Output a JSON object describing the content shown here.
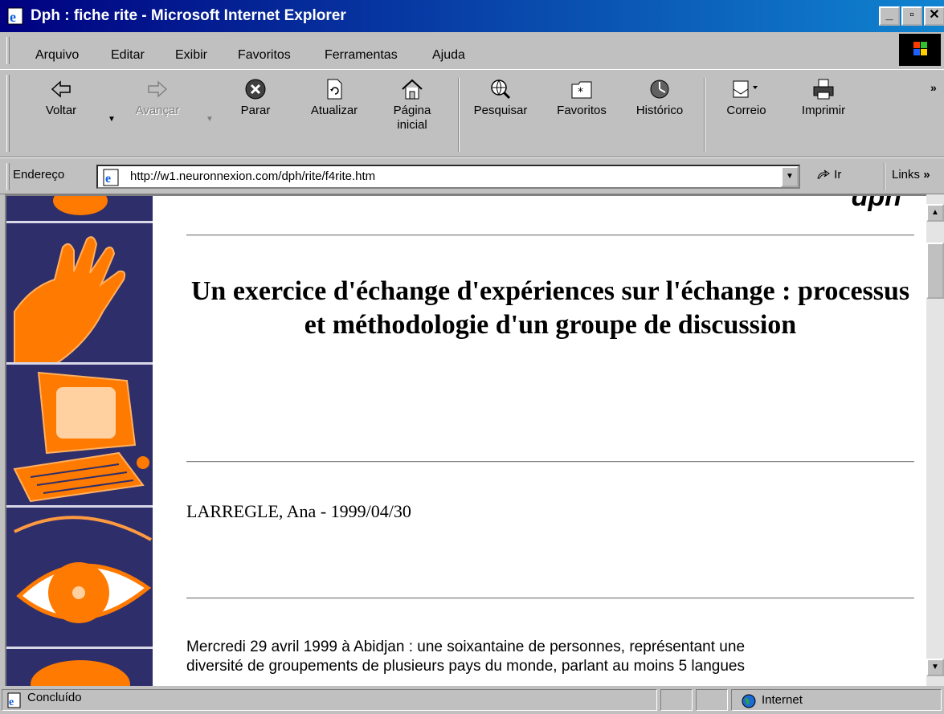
{
  "window": {
    "title": "Dph : fiche rite - Microsoft Internet Explorer",
    "min_label": "_",
    "max_label": "▫",
    "close_label": "✕"
  },
  "menu": {
    "items": [
      "Arquivo",
      "Editar",
      "Exibir",
      "Favoritos",
      "Ferramentas",
      "Ajuda"
    ]
  },
  "toolbar": {
    "back": "Voltar",
    "forward": "Avançar",
    "stop": "Parar",
    "refresh": "Atualizar",
    "home_line1": "Página",
    "home_line2": "inicial",
    "search": "Pesquisar",
    "favorites": "Favoritos",
    "history": "Histórico",
    "mail": "Correio",
    "print": "Imprimir",
    "more": "»"
  },
  "address": {
    "label": "Endereço",
    "url": "http://w1.neuronnexion.com/dph/rite/f4rite.htm",
    "go_label": "Ir",
    "links_label": "Links",
    "links_more": "»"
  },
  "page": {
    "logo": "dph",
    "title": "Un exercice d'échange d'expériences sur l'échange : processus et méthodologie d'un groupe de discussion",
    "author": "LARREGLE, Ana - 1999/04/30",
    "body_line1": "Mercredi 29 avril 1999 à Abidjan : une soixantaine de personnes, représentant une",
    "body_line2": "diversité de groupements de plusieurs pays du monde, parlant au moins 5 langues"
  },
  "status": {
    "text": "Concluído",
    "zone": "Internet"
  },
  "colors": {
    "sidebar_bg": "#2e2e6a",
    "orange": "#ff7a00",
    "titlebar": "#000080"
  },
  "icons": [
    "ie-page-icon",
    "back-arrow-icon",
    "forward-arrow-icon",
    "stop-icon",
    "refresh-icon",
    "home-icon",
    "search-globe-icon",
    "favorites-folder-icon",
    "history-icon",
    "mail-icon",
    "printer-icon",
    "go-arrow-icon",
    "globe-icon",
    "windows-logo-icon"
  ]
}
